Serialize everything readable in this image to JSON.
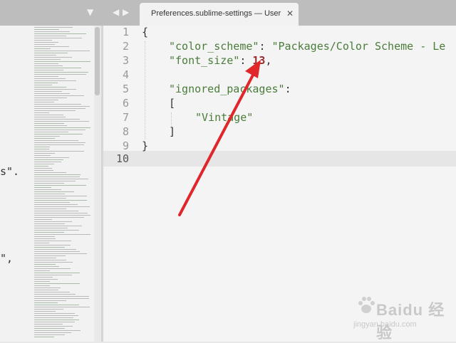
{
  "tabbar": {
    "dropdown_icon": "chevron-down-icon",
    "prev_icon": "chevron-left-icon",
    "next_icon": "chevron-right-icon",
    "tab_title": "Preferences.sublime-settings — User",
    "close_glyph": "✕"
  },
  "left_pane": {
    "visible_fragments": [
      "s\".",
      "\","
    ]
  },
  "editor": {
    "line_numbers": [
      "1",
      "2",
      "3",
      "4",
      "5",
      "6",
      "7",
      "8",
      "9",
      "10"
    ],
    "current_line": "10",
    "lines": {
      "l1": "{",
      "l2_key": "\"color_scheme\"",
      "l2_colon": ": ",
      "l2_val": "\"Packages/Color Scheme - Le",
      "l3_key": "\"font_size\"",
      "l3_colon": ": ",
      "l3_val": "13",
      "l3_comma": ",",
      "l5_key": "\"ignored_packages\"",
      "l5_colon": ":",
      "l6": "[",
      "l7_val": "\"Vintage\"",
      "l8": "]",
      "l9": "}"
    }
  },
  "annotation": {
    "arrow_color": "#e0262a"
  },
  "watermark": {
    "name": "Baidu 经验",
    "url": "jingyan.baidu.com"
  },
  "colors": {
    "string": "#4a7c3a",
    "number": "#9b2b2b",
    "tab_bg": "#f2f2f2",
    "tabbar_bg": "#bdbdbd"
  }
}
